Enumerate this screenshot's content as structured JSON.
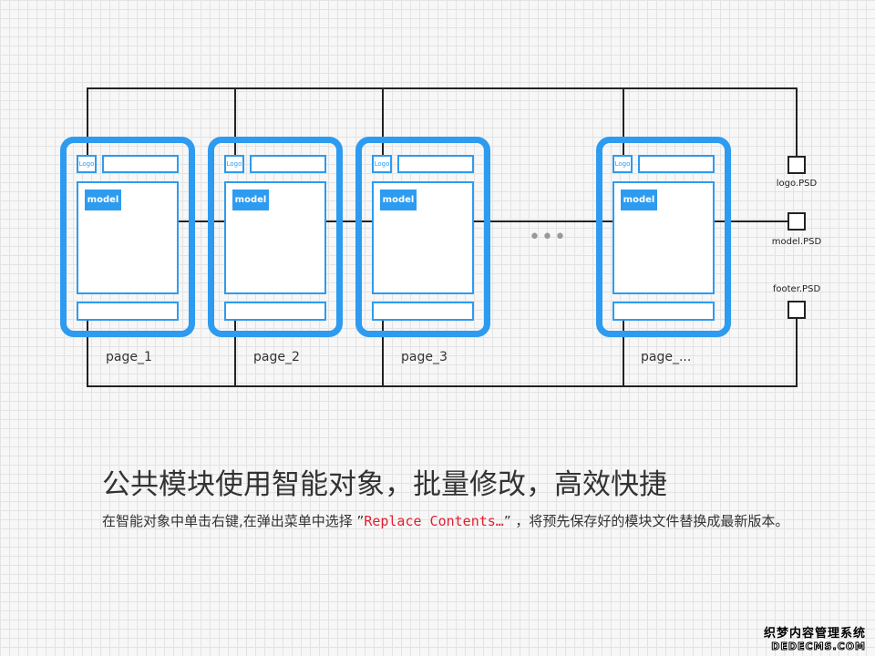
{
  "pages": [
    {
      "label": "page_1",
      "logo": "Logo",
      "model": "model"
    },
    {
      "label": "page_2",
      "logo": "Logo",
      "model": "model"
    },
    {
      "label": "page_3",
      "logo": "Logo",
      "model": "model"
    },
    {
      "label": "page_...",
      "logo": "Logo",
      "model": "model"
    }
  ],
  "ellipsis": "•••",
  "psd_files": {
    "logo": "logo.PSD",
    "model": "model.PSD",
    "footer": "footer.PSD"
  },
  "title": "公共模块使用智能对象，批量修改，高效快捷",
  "description": {
    "part1": "在智能对象中单击右键,在弹出菜单中选择 ”",
    "menu_item": "Replace Contents…",
    "part2": "” ，将预先保存好的模块文件替换成最新版本。"
  },
  "watermark": {
    "line1": "织梦内容管理系统",
    "line2": "DEDECMS.COM"
  },
  "colors": {
    "accent": "#2d9bf0",
    "line": "#222222",
    "highlight": "#e02030"
  }
}
